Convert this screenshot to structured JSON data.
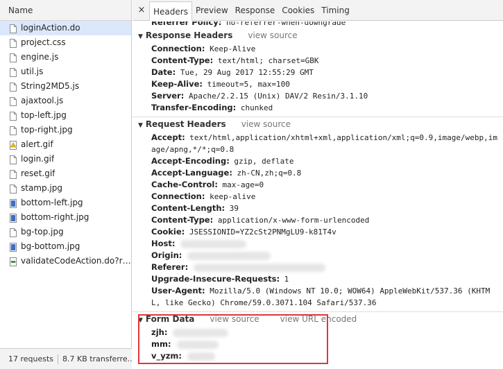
{
  "left_panel": {
    "header": "Name",
    "files": [
      {
        "name": "loginAction.do",
        "icon": "document-icon",
        "selected": true
      },
      {
        "name": "project.css",
        "icon": "document-icon"
      },
      {
        "name": "engine.js",
        "icon": "document-icon"
      },
      {
        "name": "util.js",
        "icon": "document-icon"
      },
      {
        "name": "String2MD5.js",
        "icon": "document-icon"
      },
      {
        "name": "ajaxtool.js",
        "icon": "document-icon"
      },
      {
        "name": "top-left.jpg",
        "icon": "document-icon"
      },
      {
        "name": "top-right.jpg",
        "icon": "document-icon"
      },
      {
        "name": "alert.gif",
        "icon": "warning-image-icon"
      },
      {
        "name": "login.gif",
        "icon": "document-icon"
      },
      {
        "name": "reset.gif",
        "icon": "document-icon"
      },
      {
        "name": "stamp.jpg",
        "icon": "document-icon"
      },
      {
        "name": "bottom-left.jpg",
        "icon": "blue-image-icon"
      },
      {
        "name": "bottom-right.jpg",
        "icon": "blue-image-icon"
      },
      {
        "name": "bg-top.jpg",
        "icon": "document-icon"
      },
      {
        "name": "bg-bottom.jpg",
        "icon": "blue-image-icon"
      },
      {
        "name": "validateCodeAction.do?ran...",
        "icon": "green-image-icon"
      }
    ],
    "footer": {
      "requests": "17 requests",
      "transferred": "8.7 KB transferre..."
    }
  },
  "tabs": {
    "close": "×",
    "items": [
      "Headers",
      "Preview",
      "Response",
      "Cookies",
      "Timing"
    ],
    "active": "Headers"
  },
  "top_cut_row": {
    "key": "Referrer Policy:",
    "value": " no-referrer-when-downgrade"
  },
  "response_headers": {
    "title": "Response Headers",
    "link": "view source",
    "rows": [
      {
        "key": "Connection:",
        "value": " Keep-Alive"
      },
      {
        "key": "Content-Type:",
        "value": " text/html; charset=GBK"
      },
      {
        "key": "Date:",
        "value": " Tue, 29 Aug 2017 12:55:29 GMT"
      },
      {
        "key": "Keep-Alive:",
        "value": " timeout=5, max=100"
      },
      {
        "key": "Server:",
        "value": " Apache/2.2.15 (Unix) DAV/2 Resin/3.1.10"
      },
      {
        "key": "Transfer-Encoding:",
        "value": " chunked"
      }
    ]
  },
  "request_headers": {
    "title": "Request Headers",
    "link": "view source",
    "rows": [
      {
        "key": "Accept:",
        "value": " text/html,application/xhtml+xml,application/xml;q=0.9,image/webp,image/apng,*/*;q=0.8"
      },
      {
        "key": "Accept-Encoding:",
        "value": " gzip, deflate"
      },
      {
        "key": "Accept-Language:",
        "value": " zh-CN,zh;q=0.8"
      },
      {
        "key": "Cache-Control:",
        "value": " max-age=0"
      },
      {
        "key": "Connection:",
        "value": " keep-alive"
      },
      {
        "key": "Content-Length:",
        "value": " 39"
      },
      {
        "key": "Content-Type:",
        "value": " application/x-www-form-urlencoded"
      },
      {
        "key": "Cookie:",
        "value": " JSESSIONID=YZ2cSt2PNMgLU9-k81T4v"
      },
      {
        "key": "Host:",
        "value": "",
        "blurred": true
      },
      {
        "key": "Origin:",
        "value": "",
        "blurred": true
      },
      {
        "key": "Referer:",
        "value": "",
        "blurred": true
      },
      {
        "key": "Upgrade-Insecure-Requests:",
        "value": " 1"
      },
      {
        "key": "User-Agent:",
        "value": " Mozilla/5.0 (Windows NT 10.0; WOW64) AppleWebKit/537.36 (KHTML, like Gecko) Chrome/59.0.3071.104 Safari/537.36"
      }
    ]
  },
  "form_data": {
    "title": "Form Data",
    "link_source": "view source",
    "link_url": "view URL encoded",
    "rows": [
      {
        "key": "zjh:",
        "value": "",
        "blurred": true
      },
      {
        "key": "mm:",
        "value": "",
        "blurred": true
      },
      {
        "key": "v_yzm:",
        "value": "",
        "blurred": true
      }
    ]
  },
  "colors": {
    "highlight": "#e0343b",
    "selected_row": "#dbe7fb"
  }
}
